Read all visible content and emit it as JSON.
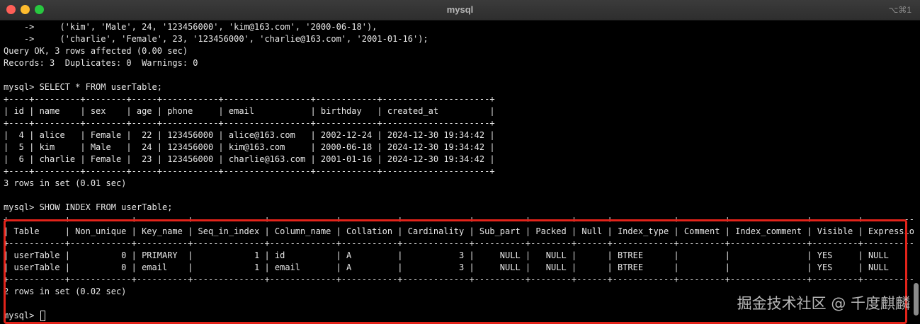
{
  "window": {
    "title": "mysql",
    "shortcut": "⌥⌘1"
  },
  "terminal": {
    "lines": [
      "    ->     ('kim', 'Male', 24, '123456000', 'kim@163.com', '2000-06-18'),",
      "    ->     ('charlie', 'Female', 23, '123456000', 'charlie@163.com', '2001-01-16');",
      "Query OK, 3 rows affected (0.00 sec)",
      "Records: 3  Duplicates: 0  Warnings: 0",
      "",
      "mysql> SELECT * FROM userTable;",
      "+----+---------+--------+-----+-----------+-----------------+------------+---------------------+",
      "| id | name    | sex    | age | phone     | email           | birthday   | created_at          |",
      "+----+---------+--------+-----+-----------+-----------------+------------+---------------------+",
      "|  4 | alice   | Female |  22 | 123456000 | alice@163.com   | 2002-12-24 | 2024-12-30 19:34:42 |",
      "|  5 | kim     | Male   |  24 | 123456000 | kim@163.com     | 2000-06-18 | 2024-12-30 19:34:42 |",
      "|  6 | charlie | Female |  23 | 123456000 | charlie@163.com | 2001-01-16 | 2024-12-30 19:34:42 |",
      "+----+---------+--------+-----+-----------+-----------------+------------+---------------------+",
      "3 rows in set (0.01 sec)",
      "",
      "mysql> SHOW INDEX FROM userTable;",
      "+-----------+------------+----------+--------------+-------------+-----------+-------------+----------+--------+------+------------+---------+---------------+---------+------------+",
      "| Table     | Non_unique | Key_name | Seq_in_index | Column_name | Collation | Cardinality | Sub_part | Packed | Null | Index_type | Comment | Index_comment | Visible | Expression |",
      "+-----------+------------+----------+--------------+-------------+-----------+-------------+----------+--------+------+------------+---------+---------------+---------+------------+",
      "| userTable |          0 | PRIMARY  |            1 | id          | A         |           3 |     NULL |   NULL |      | BTREE      |         |               | YES     | NULL       |",
      "| userTable |          0 | email    |            1 | email       | A         |           3 |     NULL |   NULL |      | BTREE      |         |               | YES     | NULL       |",
      "+-----------+------------+----------+--------------+-------------+-----------+-------------+----------+--------+------+------------+---------+---------------+---------+------------+",
      "2 rows in set (0.02 sec)",
      ""
    ],
    "prompt": "mysql> "
  },
  "watermark": "掘金技术社区 @ 千度麒麟",
  "colors": {
    "background": "#000000",
    "text": "#e8e8e8",
    "highlight_border": "#e2231a"
  }
}
